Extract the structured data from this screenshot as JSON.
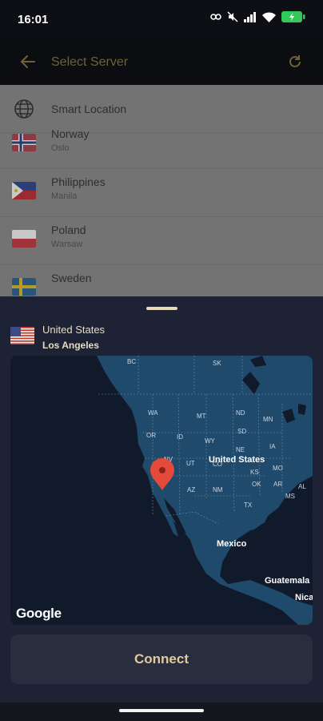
{
  "status_bar": {
    "time": "16:01"
  },
  "app_bar": {
    "title": "Select Server"
  },
  "server_list": {
    "smart_location": "Smart Location",
    "items": [
      {
        "country": "Norway",
        "city": "Oslo"
      },
      {
        "country": "Philippines",
        "city": "Manila"
      },
      {
        "country": "Poland",
        "city": "Warsaw"
      },
      {
        "country": "Sweden",
        "city": ""
      }
    ]
  },
  "selected": {
    "country": "United States",
    "city": "Los Angeles"
  },
  "map": {
    "labels": {
      "bc": "BC",
      "sk": "SK",
      "wa": "WA",
      "mt": "MT",
      "nd": "ND",
      "mn": "MN",
      "or": "OR",
      "id": "ID",
      "wy": "WY",
      "sd": "SD",
      "ia": "IA",
      "ne": "NE",
      "nv": "NV",
      "ut": "UT",
      "co": "CO",
      "mo": "MO",
      "ks": "KS",
      "az": "AZ",
      "nm": "NM",
      "ok": "OK",
      "ar": "AR",
      "tx": "TX",
      "ms": "MS",
      "al": "AL",
      "usa": "United States",
      "mexico": "Mexico",
      "guatemala": "Guatemala",
      "nicaragua": "Nica"
    },
    "attribution": "Google"
  },
  "connect_label": "Connect",
  "colors": {
    "accent": "#e7c89b",
    "sheet_bg": "#1d2334",
    "marker": "#e5493a"
  }
}
